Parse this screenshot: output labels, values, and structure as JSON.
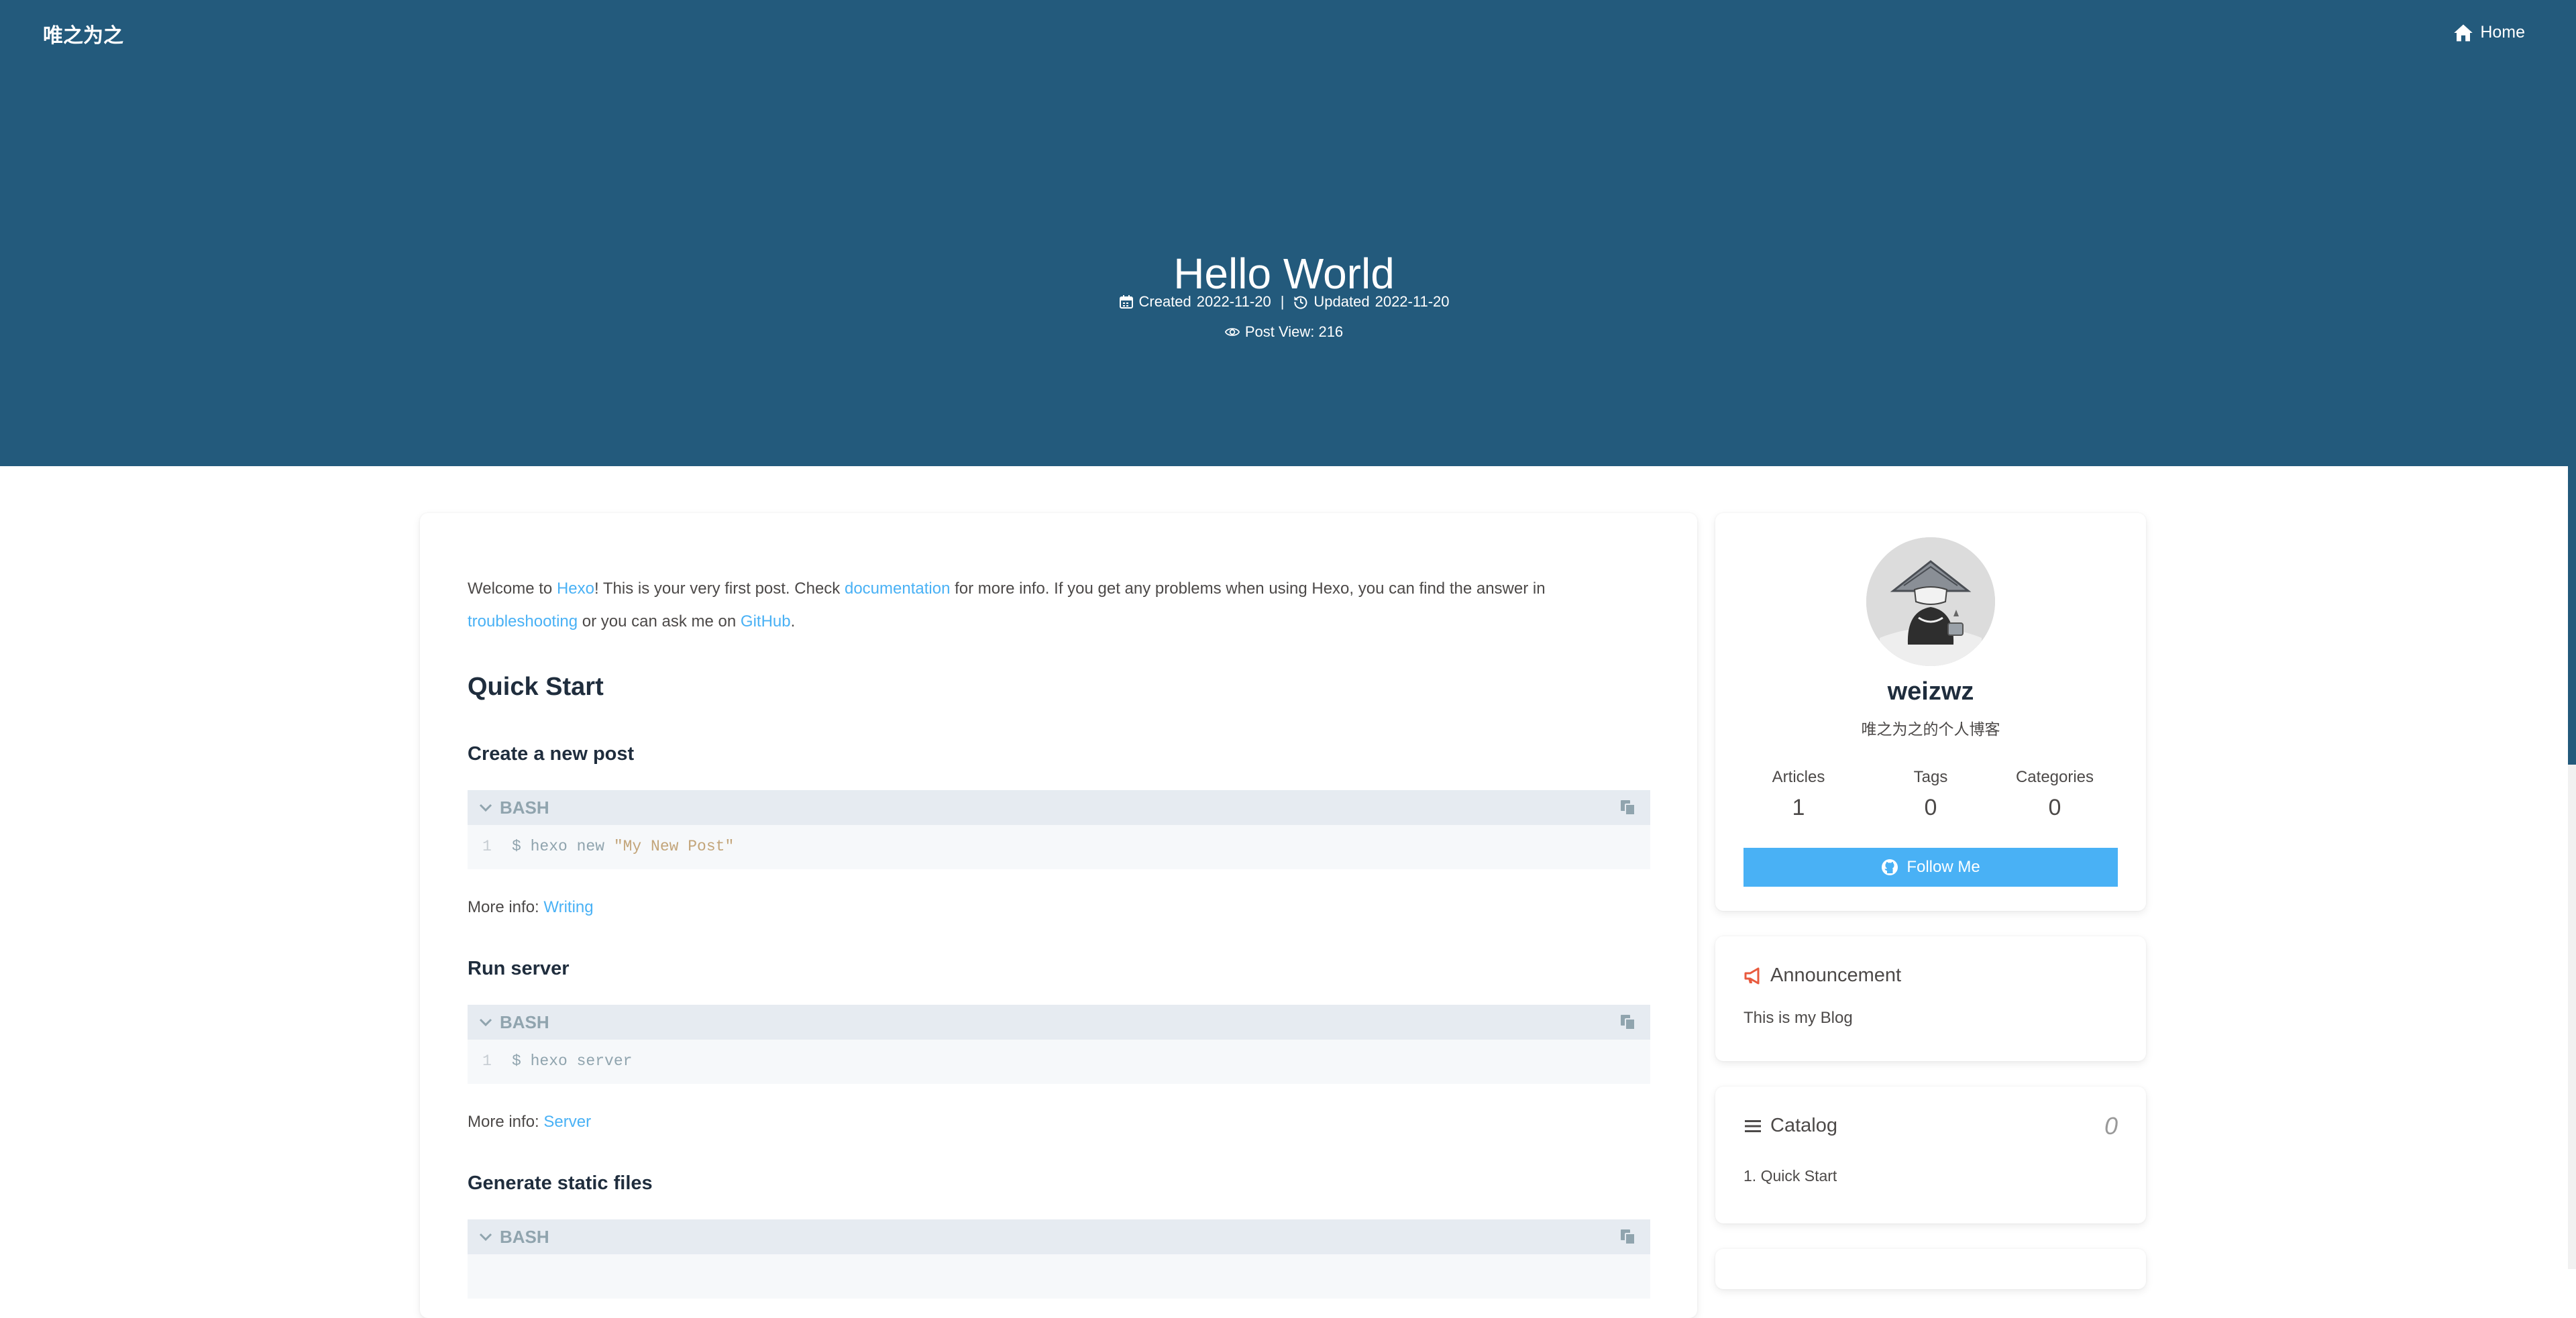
{
  "header": {
    "site_name": "唯之为之",
    "nav_home": "Home",
    "title": "Hello World",
    "created_label": "Created",
    "created_date": "2022-11-20",
    "separator": "|",
    "updated_label": "Updated",
    "updated_date": "2022-11-20",
    "post_view": "Post View: 216"
  },
  "post": {
    "intro": {
      "t1": "Welcome to ",
      "link_hexo": "Hexo",
      "t2": "! This is your very first post. Check ",
      "link_docs": "documentation",
      "t3": " for more info. If you get any problems when using Hexo, you can find the answer in ",
      "link_troubleshooting": "troubleshooting",
      "t4": " or you can ask me on ",
      "link_github": "GitHub",
      "t5": "."
    },
    "quick_start": "Quick Start",
    "sections": [
      {
        "heading": "Create a new post",
        "lang": "BASH",
        "line_no": "1",
        "code_cmd": "$ hexo new ",
        "code_str": "\"My New Post\"",
        "more_label": "More info: ",
        "more_link": "Writing"
      },
      {
        "heading": "Run server",
        "lang": "BASH",
        "line_no": "1",
        "code_cmd": "$ hexo server",
        "code_str": "",
        "more_label": "More info: ",
        "more_link": "Server"
      },
      {
        "heading": "Generate static files",
        "lang": "BASH"
      }
    ]
  },
  "aside": {
    "author": {
      "name": "weizwz",
      "description": "唯之为之的个人博客",
      "stats": [
        {
          "label": "Articles",
          "value": "1"
        },
        {
          "label": "Tags",
          "value": "0"
        },
        {
          "label": "Categories",
          "value": "0"
        }
      ],
      "follow_label": "Follow Me"
    },
    "announcement": {
      "title": "Announcement",
      "text": "This is my Blog"
    },
    "catalog": {
      "title": "Catalog",
      "percent": "0",
      "items": [
        "1. Quick Start"
      ]
    }
  },
  "colors": {
    "header_bg": "#235a7c",
    "link": "#49b1f5",
    "announcement_icon": "#e85a3e"
  },
  "icons": [
    "home-icon",
    "calendar-icon",
    "history-icon",
    "eye-icon",
    "chevron-down-icon",
    "copy-icon",
    "github-icon",
    "bullhorn-icon",
    "list-icon"
  ]
}
